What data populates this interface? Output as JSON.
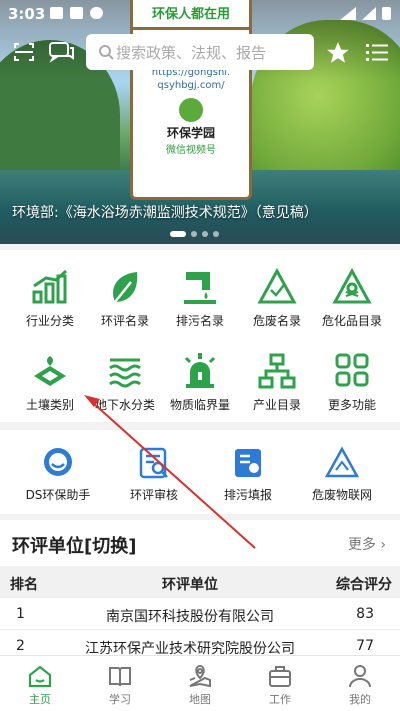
{
  "status": {
    "time": "3:03"
  },
  "banner": {
    "sign_title": "环保人都在用",
    "sign_url_1": "https://gongshi.",
    "sign_url_2": "qsyhbgj.com/",
    "sign_label": "环保学园",
    "sign_sub": "微信视频号",
    "caption": "环境部:《海水浴场赤潮监测技术规范》（意见稿）",
    "search_placeholder": "搜索政策、法规、报告"
  },
  "grid": [
    {
      "label": "行业分类",
      "icon": "bar-chart-icon"
    },
    {
      "label": "环评名录",
      "icon": "leaf-icon"
    },
    {
      "label": "排污名录",
      "icon": "pipe-icon"
    },
    {
      "label": "危废名录",
      "icon": "warning-icon"
    },
    {
      "label": "危化品目录",
      "icon": "toxic-icon"
    },
    {
      "label": "土壤类别",
      "icon": "soil-icon"
    },
    {
      "label": "地下水分类",
      "icon": "water-icon"
    },
    {
      "label": "物质临界量",
      "icon": "beacon-icon"
    },
    {
      "label": "产业目录",
      "icon": "hierarchy-icon"
    },
    {
      "label": "更多功能",
      "icon": "grid-icon"
    }
  ],
  "tools": [
    {
      "label": "DS环保助手",
      "icon": "chat-icon"
    },
    {
      "label": "环评审核",
      "icon": "review-icon"
    },
    {
      "label": "排污填报",
      "icon": "report-icon"
    },
    {
      "label": "危废物联网",
      "icon": "iot-icon"
    }
  ],
  "ranking": {
    "title": "环评单位[切换]",
    "more": "更多",
    "headers": {
      "rank": "排名",
      "unit": "环评单位",
      "score": "综合评分"
    },
    "rows": [
      {
        "rank": "1",
        "unit": "南京国环科技股份有限公司",
        "score": "83"
      },
      {
        "rank": "2",
        "unit": "江苏环保产业技术研究院股份公司",
        "score": "77"
      }
    ]
  },
  "tabbar": [
    {
      "label": "主页",
      "icon": "home-icon"
    },
    {
      "label": "学习",
      "icon": "book-icon"
    },
    {
      "label": "地图",
      "icon": "map-icon"
    },
    {
      "label": "工作",
      "icon": "briefcase-icon"
    },
    {
      "label": "我的",
      "icon": "person-icon"
    }
  ],
  "colors": {
    "accent": "#2da24a",
    "annotation": "#d9312b"
  }
}
